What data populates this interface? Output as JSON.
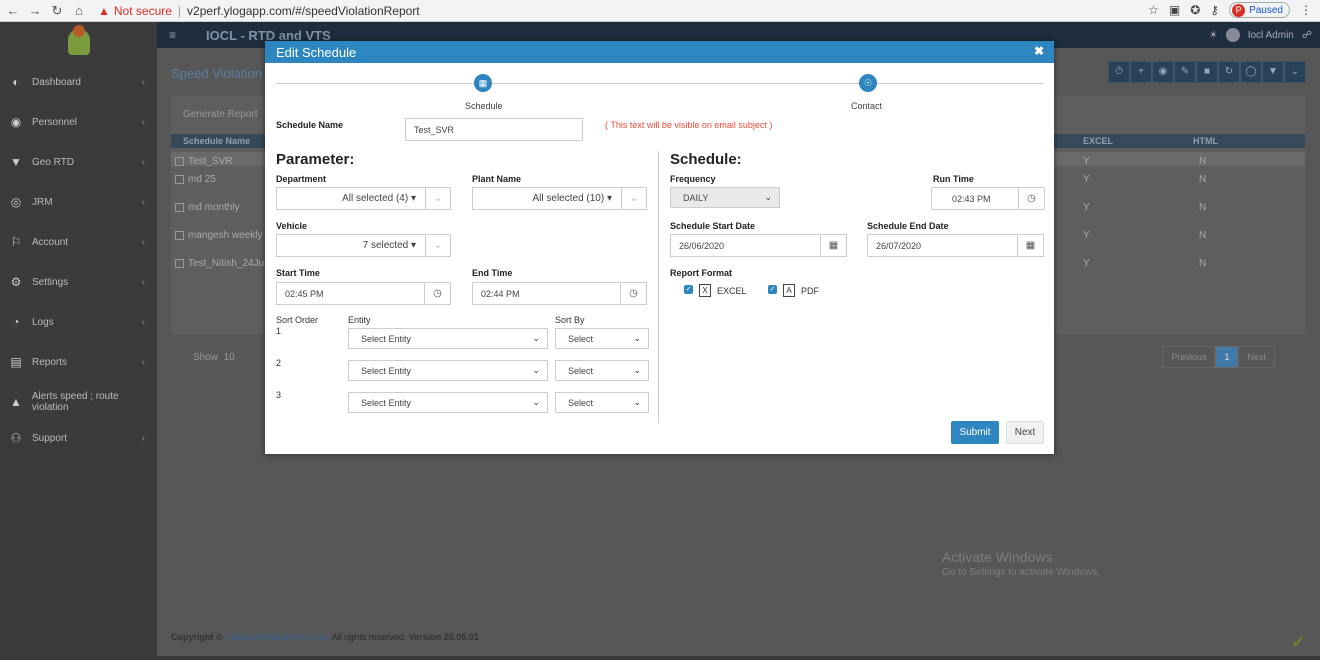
{
  "browser": {
    "not_secure": "Not secure",
    "url": "v2perf.ylogapp.com/#/speedViolationReport",
    "paused": "Paused",
    "profile": "P"
  },
  "app": {
    "title": "IOCL - RTD and VTS",
    "user": "Iocl Admin"
  },
  "sidebar": {
    "items": [
      {
        "label": "Dashboard",
        "icon": "palette-icon"
      },
      {
        "label": "Personnel",
        "icon": "users-icon"
      },
      {
        "label": "Geo RTD",
        "icon": "map-marker-icon"
      },
      {
        "label": "JRM",
        "icon": "globe-icon"
      },
      {
        "label": "Account",
        "icon": "account-icon"
      },
      {
        "label": "Settings",
        "icon": "gear-icon"
      },
      {
        "label": "Logs",
        "icon": "clock-icon"
      },
      {
        "label": "Reports",
        "icon": "report-icon"
      },
      {
        "label": "Alerts speed ; route violation",
        "icon": "bell-icon"
      },
      {
        "label": "Support",
        "icon": "support-icon"
      }
    ]
  },
  "page": {
    "title": "Speed Violation R",
    "generate_tab": "Generate Report",
    "columns": [
      "Schedule Name",
      "EXCEL",
      "HTML"
    ],
    "rows": [
      {
        "name": "Test_SVR",
        "excel": "Y",
        "html": "N"
      },
      {
        "name": "md 25",
        "excel": "Y",
        "html": "N"
      },
      {
        "name": "md monthly",
        "excel": "Y",
        "html": "N"
      },
      {
        "name": "mangesh weekly",
        "excel": "Y",
        "html": "N"
      },
      {
        "name": "Test_Nitish_24Ju",
        "excel": "Y",
        "html": "N"
      }
    ],
    "show_label": "Show",
    "show_value": "10",
    "pager": {
      "prev": "Previous",
      "current": "1",
      "next": "Next"
    },
    "footer_prefix": "Copyright ©",
    "footer_brand": "Yusata Infotech Pvt. Ltd.",
    "footer_rights": "All rights reserved.",
    "footer_version": "Version 20.05.01"
  },
  "watermark": {
    "title": "Activate Windows",
    "sub": "Go to Settings to activate Windows."
  },
  "modal": {
    "title": "Edit Schedule",
    "steps": [
      "Schedule",
      "Contact"
    ],
    "schedule_name_label": "Schedule Name",
    "schedule_name_value": "Test_SVR",
    "subject_note": "( This text will be visible on email subject )",
    "parameter": {
      "heading": "Parameter:",
      "department_label": "Department",
      "department_value": "All selected (4) ▾",
      "plant_label": "Plant Name",
      "plant_value": "All selected (10) ▾",
      "vehicle_label": "Vehicle",
      "vehicle_value": "7 selected ▾",
      "start_time_label": "Start Time",
      "start_time_value": "02:45 PM",
      "end_time_label": "End Time",
      "end_time_value": "02:44 PM",
      "sort_order_label": "Sort Order",
      "entity_label": "Entity",
      "sort_by_label": "Sort By",
      "sort_rows": [
        {
          "order": "1",
          "entity": "Select Entity",
          "sort": "Select"
        },
        {
          "order": "2",
          "entity": "Select Entity",
          "sort": "Select"
        },
        {
          "order": "3",
          "entity": "Select Entity",
          "sort": "Select"
        }
      ]
    },
    "schedule": {
      "heading": "Schedule:",
      "frequency_label": "Frequency",
      "frequency_value": "DAILY",
      "run_time_label": "Run Time",
      "run_time_value": "02:43 PM",
      "start_date_label": "Schedule Start Date",
      "start_date_value": "26/06/2020",
      "end_date_label": "Schedule End Date",
      "end_date_value": "26/07/2020",
      "format_label": "Report Format",
      "formats": [
        "EXCEL",
        "PDF"
      ]
    },
    "submit": "Submit",
    "next": "Next"
  },
  "colors": {
    "accent": "#2e86c1",
    "warning": "#e74c3c"
  }
}
